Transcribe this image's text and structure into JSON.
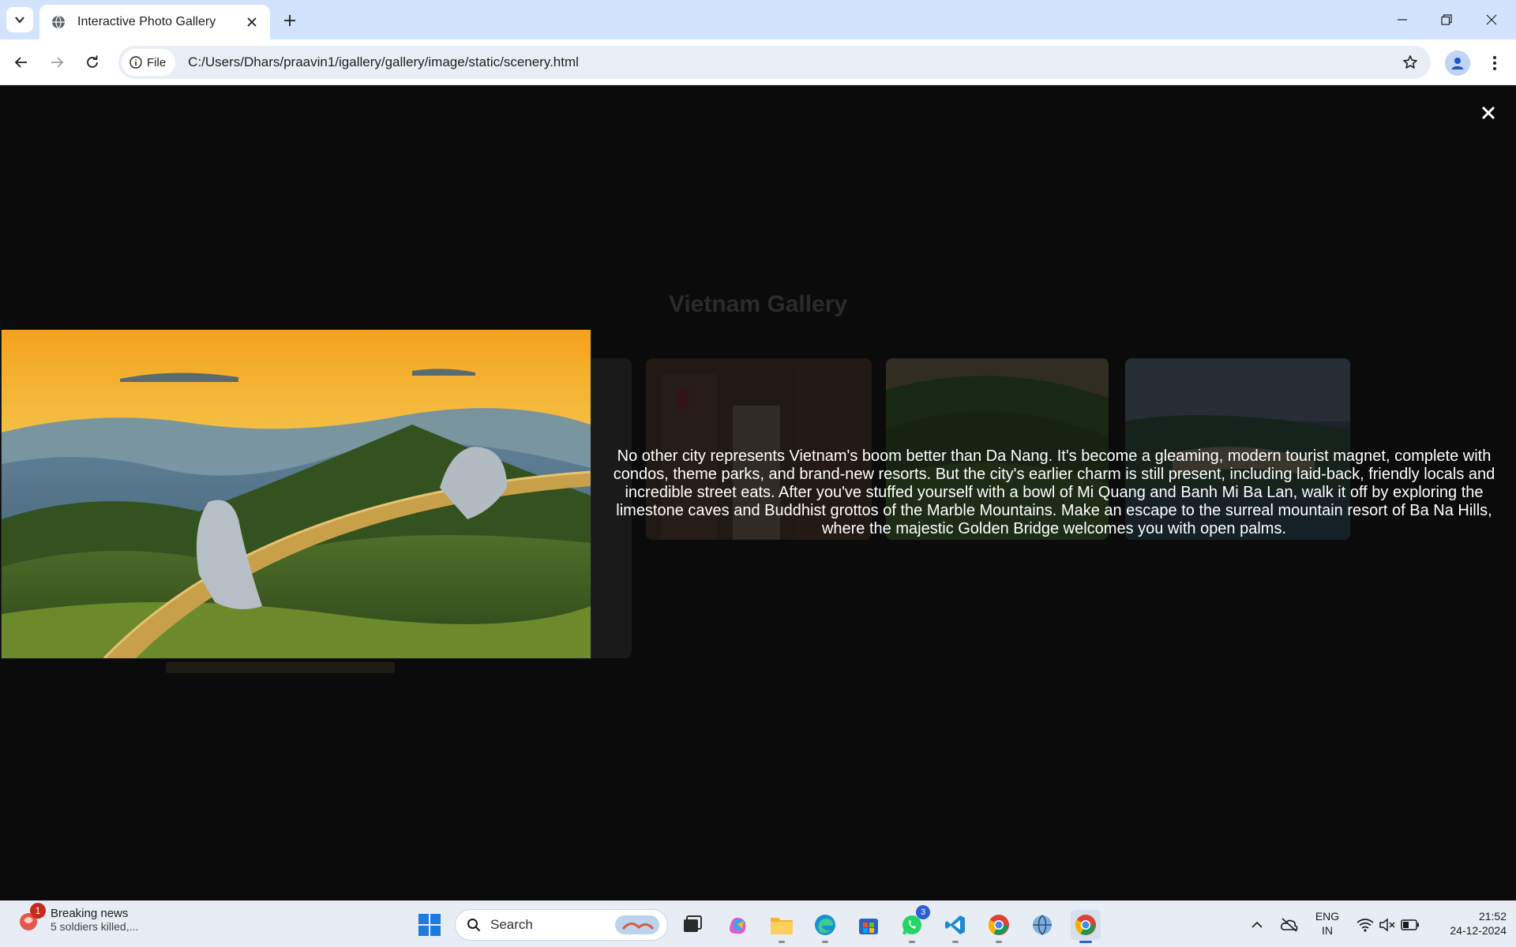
{
  "browser": {
    "tab_title": "Interactive Photo Gallery",
    "site_chip_label": "File",
    "url": "C:/Users/Dhars/praavin1/igallery/gallery/image/static/scenery.html"
  },
  "page": {
    "title": "Vietnam Gallery",
    "lightbox_description": "No other city represents Vietnam's boom better than Da Nang. It's become a gleaming, modern tourist magnet, complete with condos, theme parks, and brand-new resorts. But the city's earlier charm is still present, including laid-back, friendly locals and incredible street eats. After you've stuffed yourself with a bowl of Mi Quang and Banh Mi Ba Lan, walk it off by exploring the limestone caves and Buddhist grottos of the Marble Mountains. Make an escape to the surreal mountain resort of Ba Na Hills, where the majestic Golden Bridge welcomes you with open palms."
  },
  "taskbar": {
    "news_badge": "1",
    "news_title": "Breaking news",
    "news_subtitle": "5 soldiers killed,...",
    "search_label": "Search",
    "whatsapp_badge": "3",
    "lang_line1": "ENG",
    "lang_line2": "IN",
    "time": "21:52",
    "date": "24-12-2024"
  },
  "colors": {
    "tabbar_bg": "#d3e3fd",
    "page_bg": "#0b0b0b",
    "lightbox_text": "#ffffff",
    "taskbar_bg": "#e8edf5"
  }
}
